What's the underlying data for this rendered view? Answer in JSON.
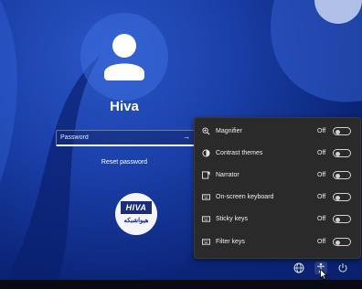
{
  "user": {
    "name": "Hiva"
  },
  "login": {
    "password_placeholder": "Password",
    "reset_label": "Reset password"
  },
  "watermark": {
    "brand": "HIVA",
    "subtitle": "هیواشبکه"
  },
  "accessibility": {
    "items": [
      {
        "label": "Magnifier",
        "state": "Off",
        "icon": "magnifier-icon"
      },
      {
        "label": "Contrast themes",
        "state": "Off",
        "icon": "contrast-icon"
      },
      {
        "label": "Narrator",
        "state": "Off",
        "icon": "narrator-icon"
      },
      {
        "label": "On-screen keyboard",
        "state": "Off",
        "icon": "keyboard-icon"
      },
      {
        "label": "Sticky keys",
        "state": "Off",
        "icon": "sticky-keys-icon"
      },
      {
        "label": "Filter keys",
        "state": "Off",
        "icon": "filter-keys-icon"
      }
    ]
  },
  "tray": {
    "icons": [
      "network-icon",
      "accessibility-icon",
      "power-icon"
    ]
  }
}
